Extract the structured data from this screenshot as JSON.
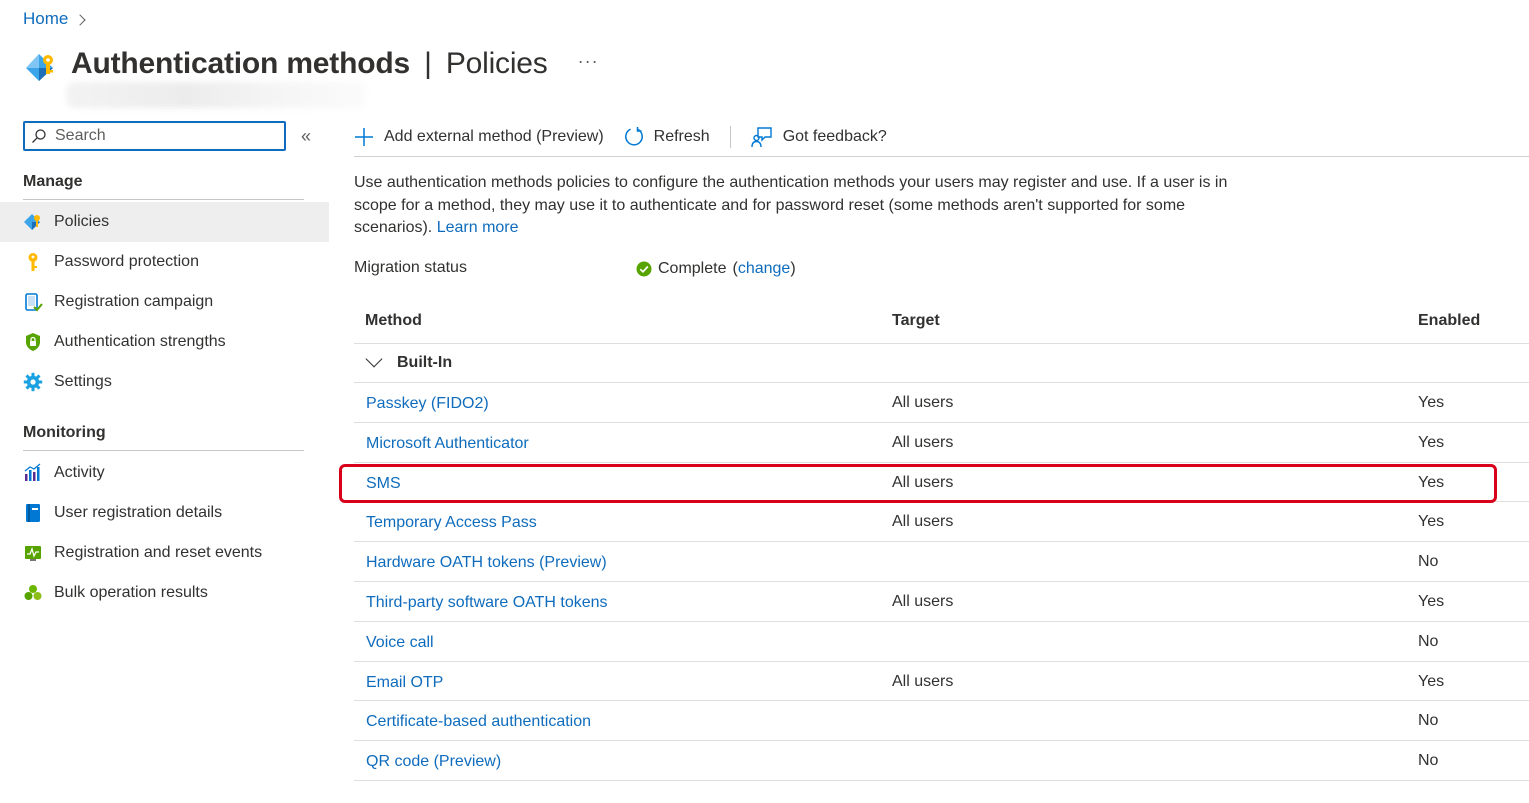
{
  "breadcrumb": {
    "home": "Home"
  },
  "header": {
    "title_main": "Authentication methods",
    "title_sep": "|",
    "title_sub": "Policies",
    "more": "···"
  },
  "sidebar": {
    "search_placeholder": "Search",
    "collapse": "«",
    "manage_heading": "Manage",
    "manage_items": [
      {
        "label": "Policies",
        "icon": "policies-icon",
        "selected": true
      },
      {
        "label": "Password protection",
        "icon": "key-icon"
      },
      {
        "label": "Registration campaign",
        "icon": "registration-campaign-icon"
      },
      {
        "label": "Authentication strengths",
        "icon": "shield-icon"
      },
      {
        "label": "Settings",
        "icon": "gear-icon"
      }
    ],
    "monitoring_heading": "Monitoring",
    "monitoring_items": [
      {
        "label": "Activity",
        "icon": "activity-chart-icon"
      },
      {
        "label": "User registration details",
        "icon": "book-icon"
      },
      {
        "label": "Registration and reset events",
        "icon": "events-monitor-icon"
      },
      {
        "label": "Bulk operation results",
        "icon": "cubes-icon"
      }
    ]
  },
  "toolbar": {
    "add_label": "Add external method (Preview)",
    "refresh_label": "Refresh",
    "feedback_label": "Got feedback?"
  },
  "description": {
    "text": "Use authentication methods policies to configure the authentication methods your users may register and use. If a user is in scope for a method, they may use it to authenticate and for password reset (some methods aren't supported for some scenarios).",
    "learn_more": "Learn more"
  },
  "migration": {
    "label": "Migration status",
    "status": "Complete",
    "open_paren": "(",
    "change": "change",
    "close_paren": ")"
  },
  "table": {
    "headers": {
      "method": "Method",
      "target": "Target",
      "enabled": "Enabled"
    },
    "group": "Built-In",
    "rows": [
      {
        "method": "Passkey (FIDO2)",
        "target": "All users",
        "enabled": "Yes"
      },
      {
        "method": "Microsoft Authenticator",
        "target": "All users",
        "enabled": "Yes"
      },
      {
        "method": "SMS",
        "target": "All users",
        "enabled": "Yes",
        "highlighted": true
      },
      {
        "method": "Temporary Access Pass",
        "target": "All users",
        "enabled": "Yes"
      },
      {
        "method": "Hardware OATH tokens (Preview)",
        "target": "",
        "enabled": "No"
      },
      {
        "method": "Third-party software OATH tokens",
        "target": "All users",
        "enabled": "Yes"
      },
      {
        "method": "Voice call",
        "target": "",
        "enabled": "No"
      },
      {
        "method": "Email OTP",
        "target": "All users",
        "enabled": "Yes"
      },
      {
        "method": "Certificate-based authentication",
        "target": "",
        "enabled": "No"
      },
      {
        "method": "QR code (Preview)",
        "target": "",
        "enabled": "No"
      }
    ]
  },
  "colors": {
    "link": "#0f6cbd",
    "highlight": "#d9001b",
    "success": "#57a300",
    "selected_bg": "#eeeeee"
  }
}
